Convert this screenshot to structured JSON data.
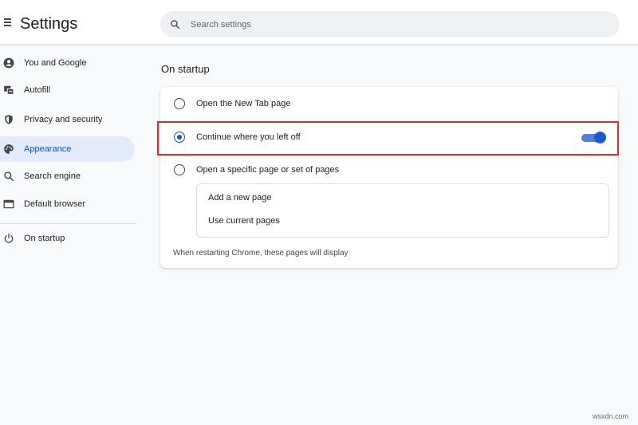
{
  "header": {
    "title": "Settings",
    "search_placeholder": "Search settings"
  },
  "sidebar": {
    "items": [
      {
        "label": "You and Google",
        "icon": "person-icon"
      },
      {
        "label": "Autofill",
        "icon": "autofill-icon"
      },
      {
        "label": "Privacy and security",
        "icon": "shield-icon"
      },
      {
        "label": "Appearance",
        "icon": "palette-icon",
        "active": true
      },
      {
        "label": "Search engine",
        "icon": "search-icon"
      },
      {
        "label": "Default browser",
        "icon": "browser-icon"
      },
      {
        "label": "On startup",
        "icon": "power-icon"
      }
    ]
  },
  "main": {
    "section_title": "On startup",
    "options": [
      {
        "label": "Open the New Tab page",
        "checked": false
      },
      {
        "label": "Continue where you left off",
        "checked": true,
        "toggle_on": true
      },
      {
        "label": "Open a specific page or set of pages",
        "checked": false
      }
    ],
    "pages_actions": [
      "Add a new page",
      "Use current pages"
    ],
    "hint": "When restarting Chrome, these pages will display"
  },
  "watermark": "wsxdn.com",
  "colors": {
    "accent": "#0b57d0",
    "active_nav_bg": "#e3ebfa",
    "highlight_border": "#d32f2f"
  }
}
